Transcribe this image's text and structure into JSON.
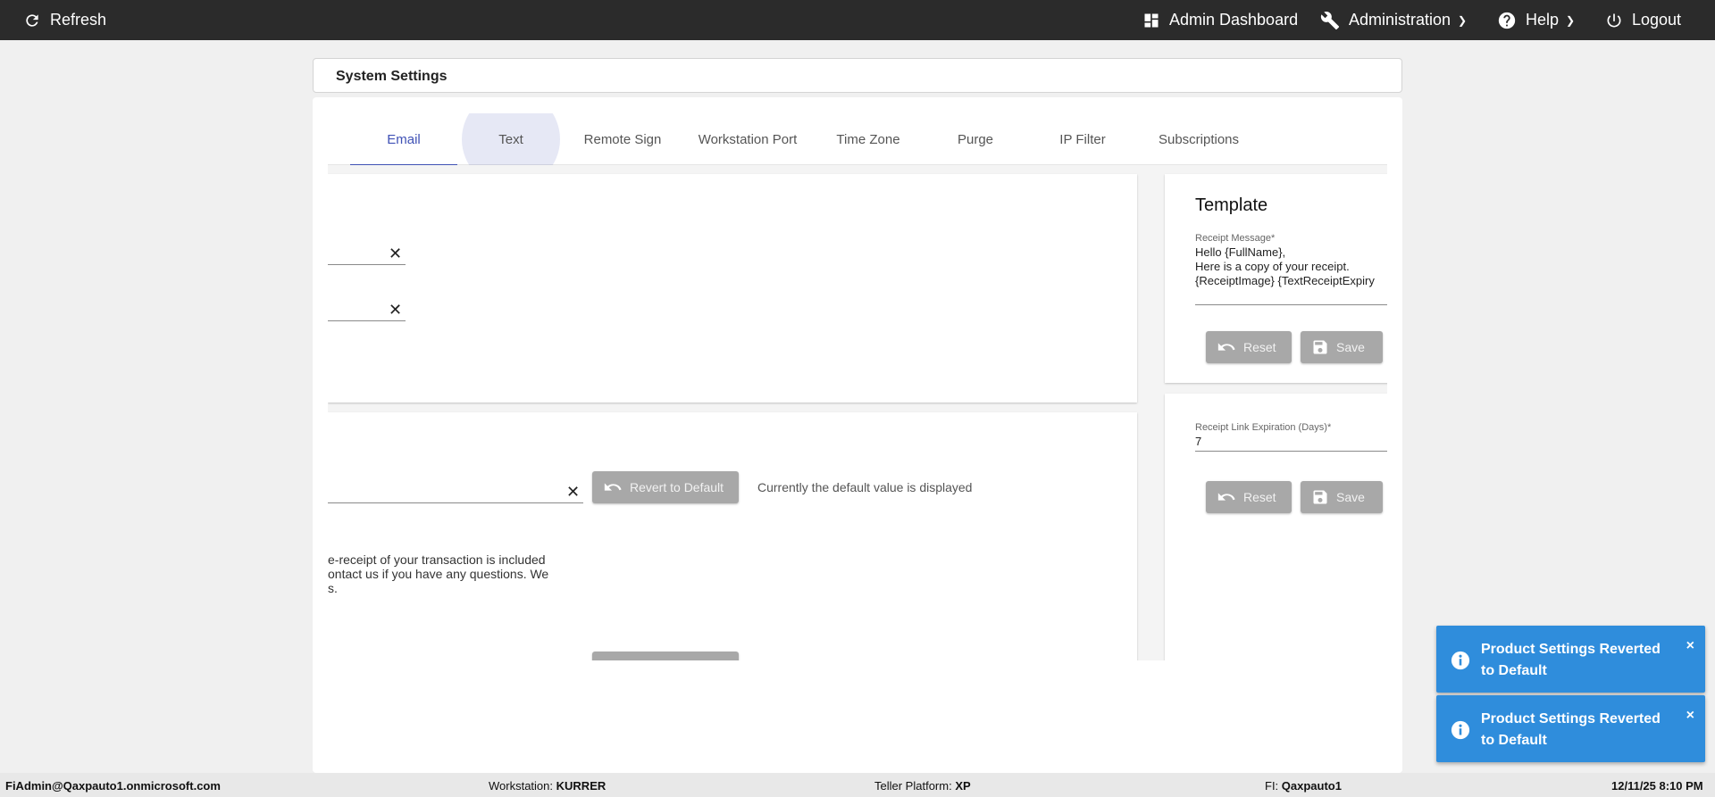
{
  "topbar": {
    "refresh": "Refresh",
    "admin_dashboard": "Admin Dashboard",
    "administration": "Administration",
    "help": "Help",
    "logout": "Logout"
  },
  "page": {
    "title": "System Settings"
  },
  "tabs": [
    {
      "label": "Email"
    },
    {
      "label": "Text"
    },
    {
      "label": "Remote Sign"
    },
    {
      "label": "Workstation Port"
    },
    {
      "label": "Time Zone"
    },
    {
      "label": "Purge"
    },
    {
      "label": "IP Filter"
    },
    {
      "label": "Subscriptions"
    }
  ],
  "email_panel": {
    "revert_label": "Revert to Default",
    "default_note": "Currently the default value is displayed",
    "body_lines": [
      "e-receipt of your transaction is included",
      "ontact us if you have any questions. We",
      "s."
    ]
  },
  "template": {
    "title": "Template",
    "receipt_message_label": "Receipt Message*",
    "receipt_message_lines": [
      "Hello {FullName},",
      "Here is a copy of your receipt.",
      "{ReceiptImage} {TextReceiptExpiry"
    ],
    "reset_label": "Reset",
    "save_label": "Save"
  },
  "expiration": {
    "label": "Receipt Link Expiration (Days)*",
    "value": "7",
    "reset_label": "Reset",
    "save_label": "Save"
  },
  "toasts": [
    {
      "message": "Product Settings Reverted to Default",
      "close": "×"
    },
    {
      "message": "Product Settings Reverted to Default",
      "close": "×"
    }
  ],
  "statusbar": {
    "user": "FiAdmin@Qaxpauto1.onmicrosoft.com",
    "workstation_label": "Workstation:",
    "workstation_value": "KURRER",
    "platform_label": "Teller Platform:",
    "platform_value": "XP",
    "fi_label": "FI:",
    "fi_value": "Qaxpauto1",
    "datetime": "12/11/25 8:10 PM"
  }
}
